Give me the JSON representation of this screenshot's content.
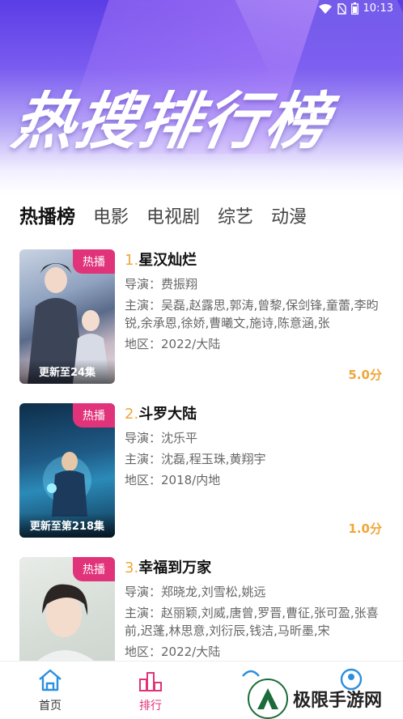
{
  "status": {
    "time": "10:13"
  },
  "hero": {
    "title": "热搜排行榜"
  },
  "tabs": [
    {
      "label": "热播榜",
      "active": true
    },
    {
      "label": "电影"
    },
    {
      "label": "电视剧"
    },
    {
      "label": "综艺"
    },
    {
      "label": "动漫"
    }
  ],
  "items": [
    {
      "rank": "1.",
      "title": "星汉灿烂",
      "badge": "热播",
      "episode": "更新至24集",
      "director": "导演：费振翔",
      "cast": "主演：吴磊,赵露思,郭涛,曾黎,保剑锋,童蕾,李昀锐,余承恩,徐娇,曹曦文,施诗,陈意涵,张",
      "region": "地区：2022/大陆",
      "score": "5.0分"
    },
    {
      "rank": "2.",
      "title": "斗罗大陆",
      "badge": "热播",
      "episode": "更新至第218集",
      "director": "导演：沈乐平",
      "cast": "主演：沈磊,程玉珠,黄翔宇",
      "region": "地区：2018/内地",
      "score": "1.0分"
    },
    {
      "rank": "3.",
      "title": "幸福到万家",
      "badge": "热播",
      "episode": "",
      "director": "导演：郑晓龙,刘雪松,姚远",
      "cast": "主演：赵丽颖,刘威,唐曾,罗晋,曹征,张可盈,张喜前,迟蓬,林思意,刘衍辰,钱洁,马昕墨,宋",
      "region": "地区：2022/大陆",
      "score": ""
    }
  ],
  "nav": [
    {
      "label": "首页",
      "color": "#333333",
      "icon": "home-icon"
    },
    {
      "label": "排行",
      "color": "#e0337a",
      "icon": "ranking-icon"
    },
    {
      "label": "",
      "color": "#2a8fe0",
      "icon": "discover-icon"
    },
    {
      "label": "",
      "color": "#2a8fe0",
      "icon": "profile-icon"
    }
  ],
  "watermark": {
    "text": "极限手游网"
  },
  "colors": {
    "accent": "#e0337a",
    "score": "#f0a63a",
    "rank": "#f0a63a"
  }
}
